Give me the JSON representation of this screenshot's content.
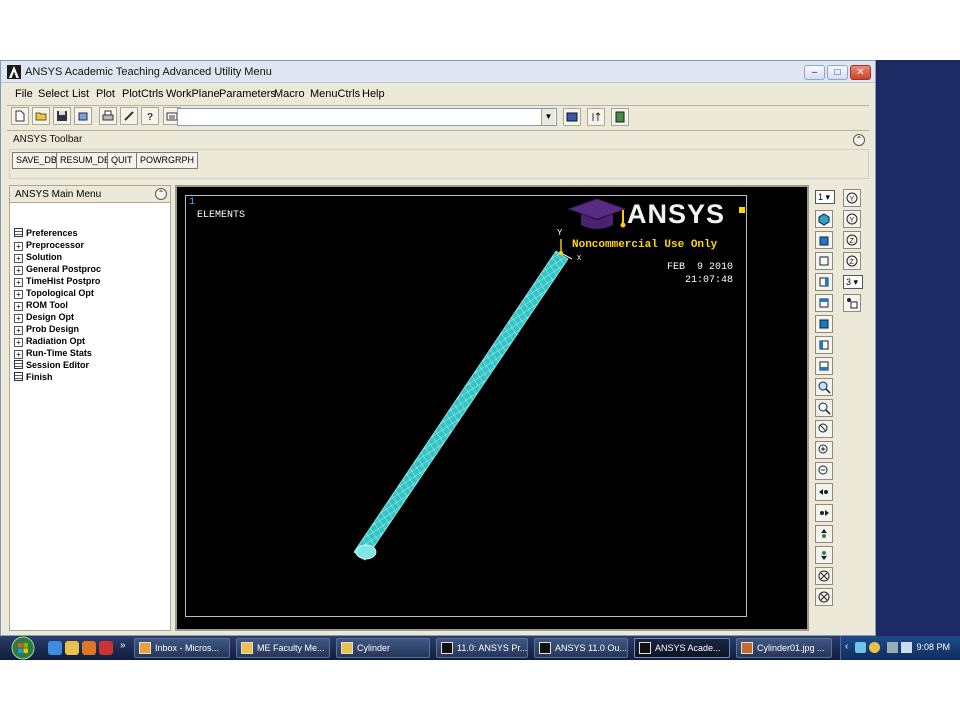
{
  "window": {
    "title": "ANSYS Academic Teaching Advanced Utility Menu"
  },
  "menubar": {
    "items": [
      "File",
      "Select",
      "List",
      "Plot",
      "PlotCtrls",
      "WorkPlane",
      "Parameters",
      "Macro",
      "MenuCtrls",
      "Help"
    ]
  },
  "command_input": {
    "value": ""
  },
  "ansys_toolbar": {
    "label": "ANSYS Toolbar",
    "buttons": [
      "SAVE_DB",
      "RESUM_DB",
      "QUIT",
      "POWRGRPH"
    ]
  },
  "main_menu": {
    "title": "ANSYS Main Menu",
    "items": [
      {
        "label": "Preferences",
        "icon": "doc"
      },
      {
        "label": "Preprocessor",
        "icon": "expand"
      },
      {
        "label": "Solution",
        "icon": "expand"
      },
      {
        "label": "General Postproc",
        "icon": "expand"
      },
      {
        "label": "TimeHist Postpro",
        "icon": "expand"
      },
      {
        "label": "Topological Opt",
        "icon": "expand"
      },
      {
        "label": "ROM Tool",
        "icon": "expand"
      },
      {
        "label": "Design Opt",
        "icon": "expand"
      },
      {
        "label": "Prob Design",
        "icon": "expand"
      },
      {
        "label": "Radiation Opt",
        "icon": "expand"
      },
      {
        "label": "Run-Time Stats",
        "icon": "expand"
      },
      {
        "label": "Session Editor",
        "icon": "doc"
      },
      {
        "label": "Finish",
        "icon": "doc"
      }
    ]
  },
  "graphics": {
    "window_number": "1",
    "plot_label": "ELEMENTS",
    "brand": "ANSYS",
    "notice": "Noncommercial Use Only",
    "date": "FEB  9 2010",
    "time": "21:07:48",
    "axis_y": "Y",
    "axis_x": "X",
    "element_color": "#33c4c4",
    "background": "#000000"
  },
  "right_toolbar": {
    "window_select": "1",
    "view_select": "3"
  },
  "taskbar": {
    "buttons": [
      {
        "label": "Inbox - Micros...",
        "icon": "outlook-icon"
      },
      {
        "label": "ME Faculty Me...",
        "icon": "mail-icon"
      },
      {
        "label": "Cylinder",
        "icon": "folder-icon"
      },
      {
        "label": "11.0: ANSYS Pr...",
        "icon": "ansys-icon"
      },
      {
        "label": "ANSYS 11.0 Ou...",
        "icon": "ansys-icon"
      },
      {
        "label": "ANSYS Acade...",
        "icon": "ansys-icon",
        "active": true
      },
      {
        "label": "Cylinder01.jpg ...",
        "icon": "image-icon"
      }
    ],
    "clock": "9:08 PM"
  }
}
